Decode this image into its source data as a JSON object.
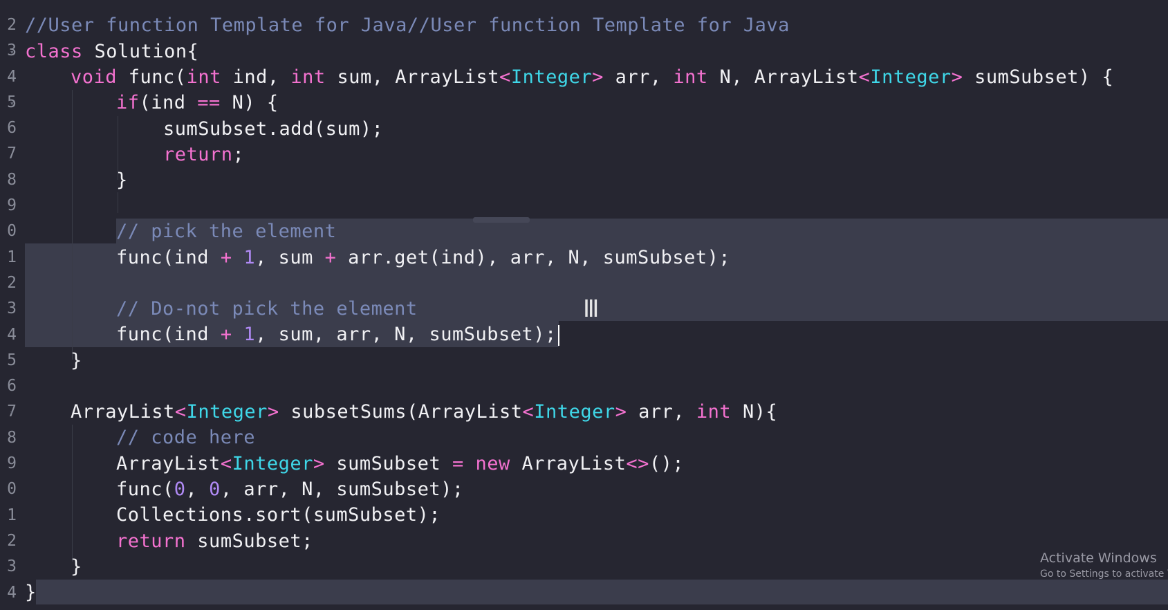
{
  "gutter": {
    "numbers": [
      "2",
      "3",
      "4",
      "5",
      "6",
      "7",
      "8",
      "9",
      "0",
      "1",
      "2",
      "3",
      "4",
      "5",
      "6",
      "7",
      "8",
      "9",
      "0",
      "1",
      "2",
      "3",
      "4"
    ]
  },
  "code": {
    "l1": "//User function Template for Java//User function Template for Java",
    "l2": {
      "kw": "class",
      "rest": " Solution{"
    },
    "l3": {
      "void": "void",
      "func": " func(",
      "int1": "int",
      "ind": " ind, ",
      "int2": "int",
      "sum": " sum, ",
      "al1": "ArrayList",
      "lt1": "<",
      "integer1": "Integer",
      "gt1": ">",
      "arr": " arr, ",
      "int3": "int",
      "n": " N, ",
      "al2": "ArrayList",
      "lt2": "<",
      "integer2": "Integer",
      "gt2": ">",
      "end": " sumSubset) {"
    },
    "l4": {
      "if": "if",
      "a": "(ind ",
      "eq": "==",
      "b": " N) {"
    },
    "l5": "sumSubset.add(sum);",
    "l6": {
      "ret": "return",
      "semi": ";"
    },
    "l7": "}",
    "l9": "// pick the element",
    "l10": {
      "a": "func(ind ",
      "p1": "+",
      "sp": " ",
      "one": "1",
      "b": ", sum ",
      "p2": "+",
      "c": " arr.get(ind), arr, N, sumSubset);"
    },
    "l12": "// Do-not pick the element",
    "l13": {
      "a": "func(ind ",
      "p": "+",
      "sp": " ",
      "one": "1",
      "b": ", sum, arr, N, sumSubset);"
    },
    "l14": "}",
    "l16": {
      "al": "ArrayList",
      "lt": "<",
      "integer": "Integer",
      "gt": ">",
      "a": " subsetSums(",
      "al2": "ArrayList",
      "lt2": "<",
      "integer2": "Integer",
      "gt2": ">",
      "b": " arr, ",
      "int": "int",
      "c": " N){"
    },
    "l17": "// code here",
    "l18": {
      "al": "ArrayList",
      "lt": "<",
      "integer": "Integer",
      "gt": ">",
      "a": " sumSubset ",
      "eq": "=",
      "sp": " ",
      "new": "new",
      "b": " ArrayList",
      "diamond": "<>",
      "c": "();"
    },
    "l19": {
      "a": "func(",
      "z1": "0",
      "comma": ", ",
      "z2": "0",
      "b": ", arr, N, sumSubset);"
    },
    "l20": "Collections.sort(sumSubset);",
    "l21": {
      "ret": "return",
      "b": " sumSubset;"
    },
    "l22": "}",
    "l23": "}"
  },
  "watermark": {
    "title": "Activate Windows",
    "subtitle": "Go to Settings to activate W"
  },
  "colors": {
    "background": "#262631",
    "keyword": "#f472d0",
    "type": "#3fd7e8",
    "number": "#b08af5",
    "comment": "#7b8ab8",
    "selection": "#3b3d4c"
  }
}
